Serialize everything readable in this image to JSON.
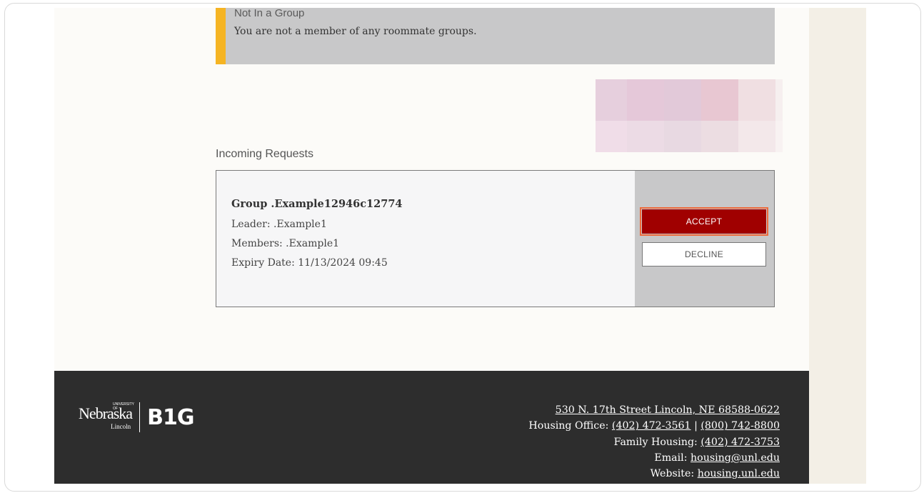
{
  "banner": {
    "title": "Not In a Group",
    "text": "You are not a member of any roommate groups."
  },
  "incoming": {
    "title": "Incoming Requests",
    "request": {
      "group": "Group .Example12946c12774",
      "leader": "Leader: .Example1",
      "members": "Members: .Example1",
      "expiry": "Expiry Date: 11/13/2024 09:45",
      "accept_label": "ACCEPT",
      "decline_label": "DECLINE"
    }
  },
  "footer": {
    "logo": {
      "university": "UNIVERSITY OF",
      "name": "Nebraska",
      "campus": "Lincoln",
      "conference": "B1G"
    },
    "address": "530 N. 17th Street Lincoln, NE 68588-0622",
    "housing_office_label": "Housing Office:",
    "housing_office_phone_1": "(402) 472-3561",
    "phone_separator": "|",
    "housing_office_phone_2": "(800) 742-8800",
    "family_housing_label": "Family Housing:",
    "family_housing_phone": "(402) 472-3753",
    "email_label": "Email:",
    "email": "housing@unl.edu",
    "website_label": "Website:",
    "website": "housing.unl.edu"
  },
  "colors": {
    "accent_yellow": "#f5b423",
    "accept_red": "#a00000",
    "focus_ring": "#ee6a3b",
    "footer_bg": "#2d2d2d",
    "page_bg": "#fcfbf8"
  }
}
